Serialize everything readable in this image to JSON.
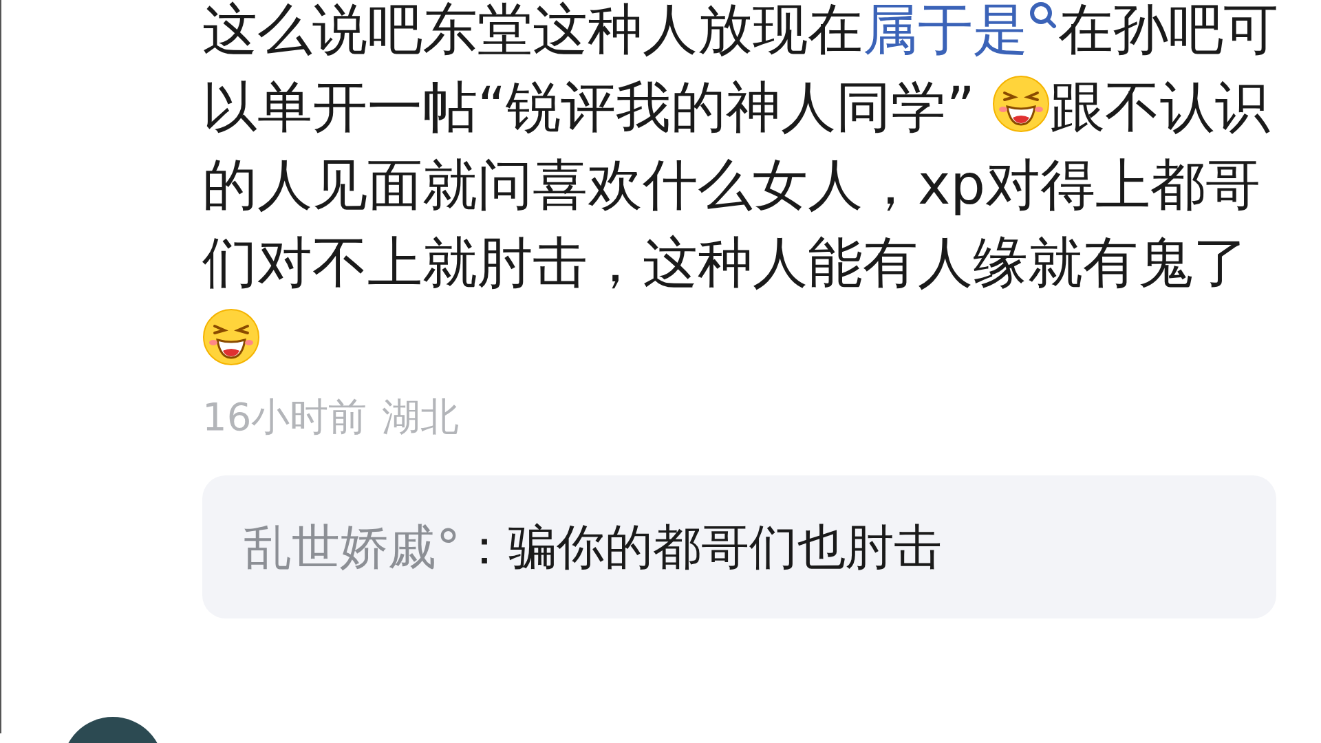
{
  "comment": {
    "segments": [
      {
        "kind": "text",
        "text": "这么说吧东堂这种人放现在"
      },
      {
        "kind": "link",
        "text": "属于是"
      },
      {
        "kind": "text",
        "text": "在孙吧可以单开一帖“锐评我的神人同学” "
      },
      {
        "kind": "emoji"
      },
      {
        "kind": "text",
        "text": "跟不认识的人见面就问喜欢什么女人，xp对得上都哥们对不上就肘击，这种人能有人缘就有鬼了 "
      },
      {
        "kind": "emoji"
      }
    ],
    "time": "16小时前",
    "location": "湖北",
    "reply": {
      "author": "乱世娇戚°",
      "separator": "：",
      "text": "骗你的都哥们也肘击"
    }
  }
}
